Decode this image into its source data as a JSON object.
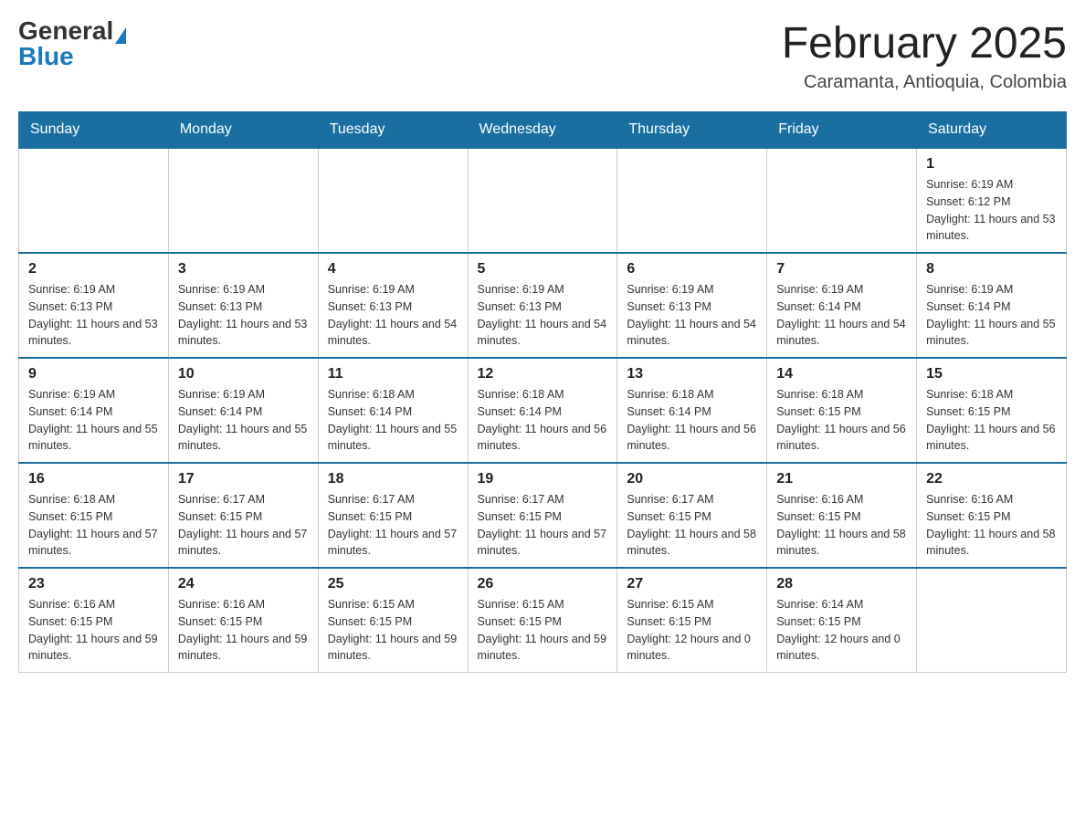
{
  "header": {
    "logo_general": "General",
    "logo_blue": "Blue",
    "month_title": "February 2025",
    "location": "Caramanta, Antioquia, Colombia"
  },
  "days_of_week": [
    "Sunday",
    "Monday",
    "Tuesday",
    "Wednesday",
    "Thursday",
    "Friday",
    "Saturday"
  ],
  "weeks": [
    {
      "days": [
        {
          "num": "",
          "info": ""
        },
        {
          "num": "",
          "info": ""
        },
        {
          "num": "",
          "info": ""
        },
        {
          "num": "",
          "info": ""
        },
        {
          "num": "",
          "info": ""
        },
        {
          "num": "",
          "info": ""
        },
        {
          "num": "1",
          "info": "Sunrise: 6:19 AM\nSunset: 6:12 PM\nDaylight: 11 hours and 53 minutes."
        }
      ]
    },
    {
      "days": [
        {
          "num": "2",
          "info": "Sunrise: 6:19 AM\nSunset: 6:13 PM\nDaylight: 11 hours and 53 minutes."
        },
        {
          "num": "3",
          "info": "Sunrise: 6:19 AM\nSunset: 6:13 PM\nDaylight: 11 hours and 53 minutes."
        },
        {
          "num": "4",
          "info": "Sunrise: 6:19 AM\nSunset: 6:13 PM\nDaylight: 11 hours and 54 minutes."
        },
        {
          "num": "5",
          "info": "Sunrise: 6:19 AM\nSunset: 6:13 PM\nDaylight: 11 hours and 54 minutes."
        },
        {
          "num": "6",
          "info": "Sunrise: 6:19 AM\nSunset: 6:13 PM\nDaylight: 11 hours and 54 minutes."
        },
        {
          "num": "7",
          "info": "Sunrise: 6:19 AM\nSunset: 6:14 PM\nDaylight: 11 hours and 54 minutes."
        },
        {
          "num": "8",
          "info": "Sunrise: 6:19 AM\nSunset: 6:14 PM\nDaylight: 11 hours and 55 minutes."
        }
      ]
    },
    {
      "days": [
        {
          "num": "9",
          "info": "Sunrise: 6:19 AM\nSunset: 6:14 PM\nDaylight: 11 hours and 55 minutes."
        },
        {
          "num": "10",
          "info": "Sunrise: 6:19 AM\nSunset: 6:14 PM\nDaylight: 11 hours and 55 minutes."
        },
        {
          "num": "11",
          "info": "Sunrise: 6:18 AM\nSunset: 6:14 PM\nDaylight: 11 hours and 55 minutes."
        },
        {
          "num": "12",
          "info": "Sunrise: 6:18 AM\nSunset: 6:14 PM\nDaylight: 11 hours and 56 minutes."
        },
        {
          "num": "13",
          "info": "Sunrise: 6:18 AM\nSunset: 6:14 PM\nDaylight: 11 hours and 56 minutes."
        },
        {
          "num": "14",
          "info": "Sunrise: 6:18 AM\nSunset: 6:15 PM\nDaylight: 11 hours and 56 minutes."
        },
        {
          "num": "15",
          "info": "Sunrise: 6:18 AM\nSunset: 6:15 PM\nDaylight: 11 hours and 56 minutes."
        }
      ]
    },
    {
      "days": [
        {
          "num": "16",
          "info": "Sunrise: 6:18 AM\nSunset: 6:15 PM\nDaylight: 11 hours and 57 minutes."
        },
        {
          "num": "17",
          "info": "Sunrise: 6:17 AM\nSunset: 6:15 PM\nDaylight: 11 hours and 57 minutes."
        },
        {
          "num": "18",
          "info": "Sunrise: 6:17 AM\nSunset: 6:15 PM\nDaylight: 11 hours and 57 minutes."
        },
        {
          "num": "19",
          "info": "Sunrise: 6:17 AM\nSunset: 6:15 PM\nDaylight: 11 hours and 57 minutes."
        },
        {
          "num": "20",
          "info": "Sunrise: 6:17 AM\nSunset: 6:15 PM\nDaylight: 11 hours and 58 minutes."
        },
        {
          "num": "21",
          "info": "Sunrise: 6:16 AM\nSunset: 6:15 PM\nDaylight: 11 hours and 58 minutes."
        },
        {
          "num": "22",
          "info": "Sunrise: 6:16 AM\nSunset: 6:15 PM\nDaylight: 11 hours and 58 minutes."
        }
      ]
    },
    {
      "days": [
        {
          "num": "23",
          "info": "Sunrise: 6:16 AM\nSunset: 6:15 PM\nDaylight: 11 hours and 59 minutes."
        },
        {
          "num": "24",
          "info": "Sunrise: 6:16 AM\nSunset: 6:15 PM\nDaylight: 11 hours and 59 minutes."
        },
        {
          "num": "25",
          "info": "Sunrise: 6:15 AM\nSunset: 6:15 PM\nDaylight: 11 hours and 59 minutes."
        },
        {
          "num": "26",
          "info": "Sunrise: 6:15 AM\nSunset: 6:15 PM\nDaylight: 11 hours and 59 minutes."
        },
        {
          "num": "27",
          "info": "Sunrise: 6:15 AM\nSunset: 6:15 PM\nDaylight: 12 hours and 0 minutes."
        },
        {
          "num": "28",
          "info": "Sunrise: 6:14 AM\nSunset: 6:15 PM\nDaylight: 12 hours and 0 minutes."
        },
        {
          "num": "",
          "info": ""
        }
      ]
    }
  ]
}
